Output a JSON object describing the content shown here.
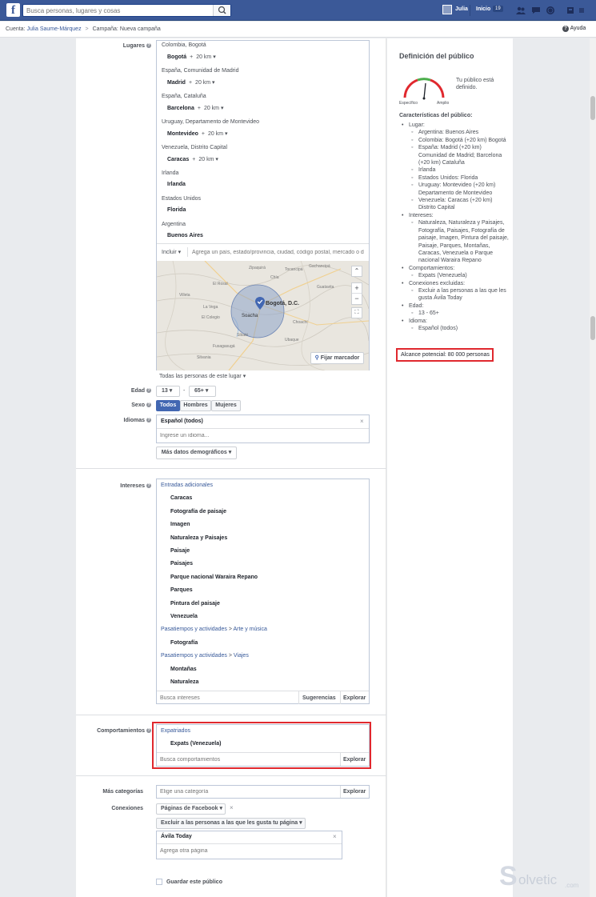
{
  "topbar": {
    "logo": "f",
    "search_placeholder": "Busca personas, lugares y cosas",
    "user_name": "Julia",
    "home_label": "Inicio",
    "home_count": "19"
  },
  "breadcrumb": {
    "account_prefix": "Cuenta:",
    "account_name": "Julia Saume-Márquez",
    "separator": ">",
    "campaign_prefix": "Campaña:",
    "campaign_name": "Nueva campaña",
    "help_label": "Ayuda"
  },
  "locations": {
    "label": "Lugares",
    "items": [
      {
        "sub": "Colombia, Bogotá",
        "main": "Bogotá",
        "radius": "20 km"
      },
      {
        "sub": "España, Comunidad de Madrid",
        "main": "Madrid",
        "radius": "20 km"
      },
      {
        "sub": "España, Cataluña",
        "main": "Barcelona",
        "radius": "20 km"
      },
      {
        "sub": "Uruguay, Departamento de Montevideo",
        "main": "Montevideo",
        "radius": "20 km"
      },
      {
        "sub": "Venezuela, Distrito Capital",
        "main": "Caracas",
        "radius": "20 km"
      },
      {
        "sub": "Irlanda",
        "main": "Irlanda",
        "radius": ""
      },
      {
        "sub": "Estados Unidos",
        "main": "Florida",
        "radius": ""
      },
      {
        "sub": "Argentina",
        "main": "Buenos Aires",
        "radius": ""
      }
    ],
    "include_label": "Incluir",
    "search_placeholder": "Agrega un país, estado/provincia, ciudad, código postal, mercado o d",
    "pin_button": "Fijar marcador",
    "map_labels": [
      "Bogotá, D.C.",
      "Soacha",
      "Chía",
      "El Rosal",
      "Sibaté",
      "La Vega",
      "El Colegio",
      "Villeta",
      "Tocancipá",
      "Gachancipá",
      "Zipaquirá",
      "Guatavita",
      "Fusagasugá",
      "Silvania",
      "Choachí",
      "Ubaque"
    ],
    "people_filter": "Todas las personas de este lugar"
  },
  "age": {
    "label": "Edad",
    "min": "13",
    "dash": "-",
    "max": "65+"
  },
  "gender": {
    "label": "Sexo",
    "options": [
      "Todos",
      "Hombres",
      "Mujeres"
    ]
  },
  "languages": {
    "label": "Idiomas",
    "selected": "Español (todos)",
    "placeholder": "Ingrese un idioma...",
    "more_button": "Más datos demográficos"
  },
  "interests": {
    "label": "Intereses",
    "groups": [
      {
        "header_parts": [
          "Entradas adicionales"
        ],
        "items": [
          "Caracas",
          "Fotografía de paisaje",
          "Imagen",
          "Naturaleza y Paisajes",
          "Paisaje",
          "Paisajes",
          "Parque nacional Waraira Repano",
          "Parques",
          "Pintura del paisaje",
          "Venezuela"
        ]
      },
      {
        "header_parts": [
          "Pasatiempos y actividades",
          "Arte y música"
        ],
        "items": [
          "Fotografía"
        ]
      },
      {
        "header_parts": [
          "Pasatiempos y actividades",
          "Viajes"
        ],
        "items": [
          "Montañas",
          "Naturaleza"
        ]
      }
    ],
    "search_placeholder": "Busca intereses",
    "suggestions": "Sugerencias",
    "explore": "Explorar"
  },
  "behaviors": {
    "label": "Comportamientos",
    "group": "Expatriados",
    "item": "Expats (Venezuela)",
    "search_placeholder": "Busca comportamientos",
    "explore": "Explorar"
  },
  "more_categories": {
    "label": "Más categorías",
    "placeholder": "Elige una categoría",
    "explore": "Explorar"
  },
  "connections": {
    "label": "Conexiones",
    "type": "Páginas de Facebook",
    "exclude_button": "Excluir a las personas a las que les gusta tu página",
    "page": "Ávila Today",
    "placeholder": "Agrega otra página"
  },
  "save_audience": "Guardar este público",
  "audience": {
    "title": "Definición del público",
    "gauge_left": "Específico",
    "gauge_right": "Amplio",
    "status": "Tu público está definido.",
    "chars_title": "Características del público:",
    "sections": [
      {
        "label": "Lugar:",
        "items": [
          "Argentina: Buenos Aires",
          "Colombia: Bogotá (+20 km) Bogotá",
          "España: Madrid (+20 km) Comunidad de Madrid; Barcelona (+20 km) Cataluña",
          "Irlanda",
          "Estados Unidos: Florida",
          "Uruguay: Montevideo (+20 km) Departamento de Montevideo",
          "Venezuela: Caracas (+20 km) Distrito Capital"
        ]
      },
      {
        "label": "Intereses:",
        "items": [
          "Naturaleza, Naturaleza y Paisajes, Fotografía, Paisajes, Fotografía de paisaje, Imagen, Pintura del paisaje, Paisaje, Parques, Montañas, Caracas, Venezuela o Parque nacional Waraira Repano"
        ]
      },
      {
        "label": "Comportamientos:",
        "items": [
          "Expats (Venezuela)"
        ]
      },
      {
        "label": "Conexiones excluidas:",
        "items": [
          "Excluir a las personas a las que les gusta Ávila Today"
        ]
      },
      {
        "label": "Edad:",
        "items": [
          "13 - 65+"
        ]
      },
      {
        "label": "Idioma:",
        "items": [
          "Español (todos)"
        ]
      }
    ],
    "reach": "Alcance potencial: 80 000 personas"
  },
  "watermark": {
    "brand": "olvetic",
    "domain": ".com"
  },
  "colors": {
    "facebook_blue": "#3b5998",
    "link": "#365899",
    "highlight_red": "#e0282e",
    "selected_button": "#4267b2"
  }
}
